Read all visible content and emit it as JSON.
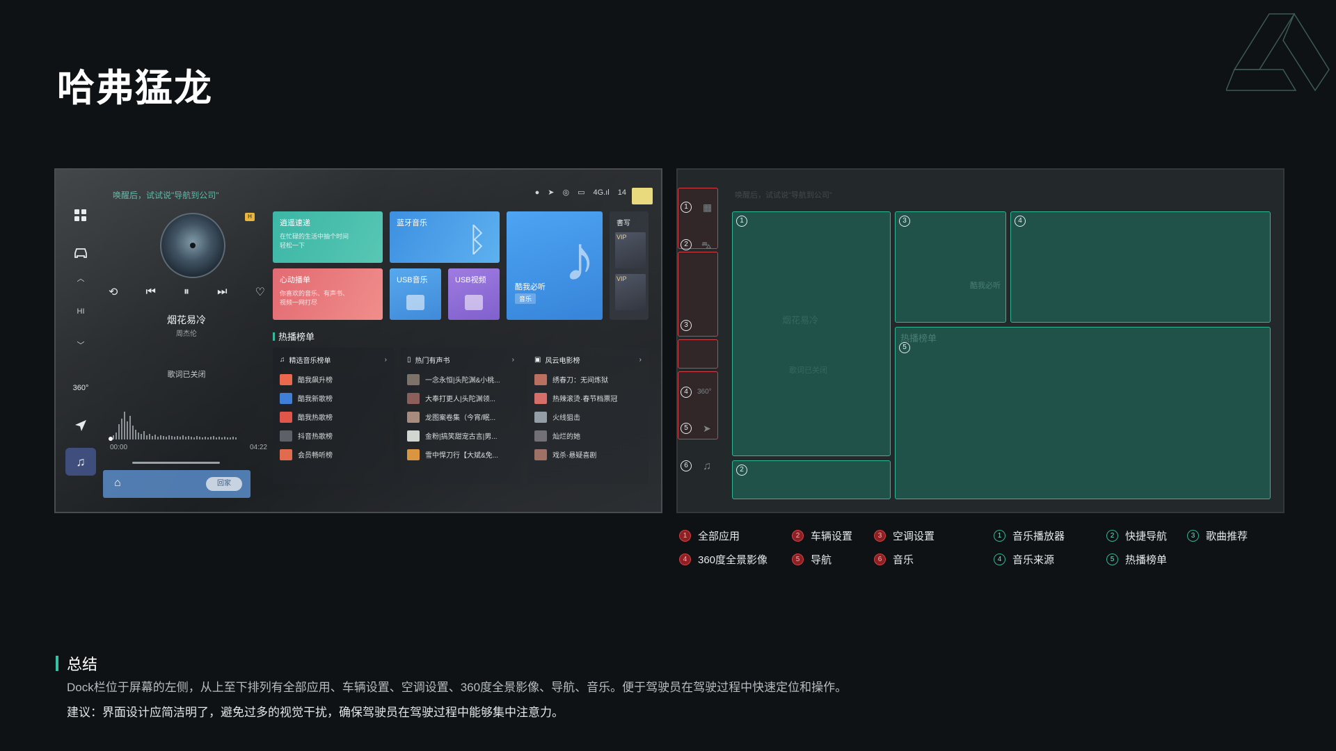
{
  "page": {
    "title": "哈弗猛龙"
  },
  "screen": {
    "voice_hint": "唤醒后，试试说\"导航到公司\"",
    "status_icons": [
      "mic-icon",
      "nav-icon",
      "cam-icon",
      "screen-icon",
      "signal-4g-icon"
    ],
    "status_signal": "4G.ıl",
    "status_time": "14",
    "player": {
      "quality_badge": "H",
      "title": "烟花易冷",
      "artist": "周杰伦",
      "lyrics_status": "歌词已关闭",
      "time_current": "00:00",
      "time_total": "04:22",
      "home_pill": "回家"
    },
    "tiles": {
      "teal": {
        "title": "逍遥速递",
        "sub": "在忙碌的生活中抽个时间轻松一下"
      },
      "coral": {
        "title": "心动播单",
        "sub": "你喜欢的音乐、有声书、视频一网打尽"
      },
      "bluetooth": {
        "title": "蓝牙音乐"
      },
      "usb_music": {
        "title": "USB音乐"
      },
      "usb_video": {
        "title": "USB视频"
      },
      "kuwo": {
        "title": "酷我必听",
        "tag": "音乐"
      },
      "book": {
        "title": "書写",
        "vip_tag_1": "VIP",
        "vip_tag_2": "VIP"
      }
    },
    "hot_title": "热播榜单",
    "hot_columns": [
      {
        "header": "精选音乐榜单",
        "rows": [
          "酷我飙升榜",
          "酷我新歌榜",
          "酷我热歌榜",
          "抖音热歌榜",
          "会员畅听榜"
        ]
      },
      {
        "header": "热门有声书",
        "rows": [
          "一念永恒|头陀渊&小桃...",
          "大奉打更人|头陀渊领...",
          "龙图案卷集（今宵/眠...",
          "金粉|搞笑甜宠古言|男...",
          "雪中悍刀行【大斌&免..."
        ]
      },
      {
        "header": "风云电影榜",
        "rows": [
          "绣春刀：无间炼狱",
          "热辣滚烫·春节档票冠",
          "火线狙击",
          "灿烂的她",
          "戏杀·悬疑喜剧"
        ]
      }
    ],
    "thumb_colors": [
      [
        "#e9684d",
        "#3e7fd6",
        "#e2544a",
        "#5b5f66",
        "#e06a4c"
      ],
      [
        "#7a6f66",
        "#8b5c58",
        "#a58a7a",
        "#cfd6cf",
        "#d9923c"
      ],
      [
        "#b76b5a",
        "#d46a64",
        "#8f9aa3",
        "#6d6a70",
        "#9a6b60"
      ]
    ]
  },
  "annotation": {
    "red_labels": [
      "1",
      "2",
      "3",
      "4",
      "5",
      "6"
    ],
    "green_labels": [
      "1",
      "2",
      "3",
      "4",
      "5"
    ]
  },
  "legend": {
    "red": [
      {
        "num": "1",
        "label": "全部应用"
      },
      {
        "num": "2",
        "label": "车辆设置"
      },
      {
        "num": "3",
        "label": "空调设置"
      },
      {
        "num": "4",
        "label": "360度全景影像"
      },
      {
        "num": "5",
        "label": "导航"
      },
      {
        "num": "6",
        "label": "音乐"
      }
    ],
    "green": [
      {
        "num": "1",
        "label": "音乐播放器"
      },
      {
        "num": "2",
        "label": "快捷导航"
      },
      {
        "num": "3",
        "label": "歌曲推荐"
      },
      {
        "num": "4",
        "label": "音乐来源"
      },
      {
        "num": "5",
        "label": "热播榜单"
      }
    ]
  },
  "summary": {
    "heading": "总结",
    "p1": "Dock栏位于屏幕的左侧，从上至下排列有全部应用、车辆设置、空调设置、360度全景影像、导航、音乐。便于驾驶员在驾驶过程中快速定位和操作。",
    "p2": "建议：界面设计应简洁明了，避免过多的视觉干扰，确保驾驶员在驾驶过程中能够集中注意力。"
  },
  "colors": {
    "accent_green": "#2fb694",
    "accent_red": "#d53f44",
    "dock_active": "#3b4a7a"
  }
}
